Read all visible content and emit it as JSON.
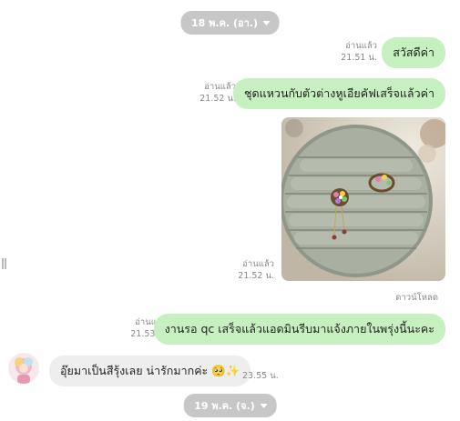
{
  "chat": {
    "date_top": "18 พ.ค. (อา.)",
    "date_bottom": "19 พ.ค. (จ.)",
    "download_label": "ดาวน์โหลด",
    "messages": [
      {
        "side": "out",
        "text": "สวัสดีค่า",
        "status": "อ่านแล้ว",
        "time": "21.51 น."
      },
      {
        "side": "out",
        "text": "ชุดแหวนกับตัวต่างหูเอียคัฟเสร็จแล้วค่า",
        "status": "อ่านแล้ว",
        "time": "21.52 น."
      },
      {
        "side": "out",
        "type": "image",
        "status": "อ่านแล้ว",
        "time": "21.52 น."
      },
      {
        "side": "out",
        "text": "งานรอ qc เสร็จแล้วแอดมินรีบมาแจ้งภายในพรุ่งนี้นะคะ",
        "status": "อ่านแล้ว",
        "time": "21.53 น."
      },
      {
        "side": "in",
        "text": "อุ๊ยมาเป็นสีรุ้งเลย น่ารักมากค่ะ 🥺✨",
        "time": "23.55 น."
      }
    ]
  }
}
